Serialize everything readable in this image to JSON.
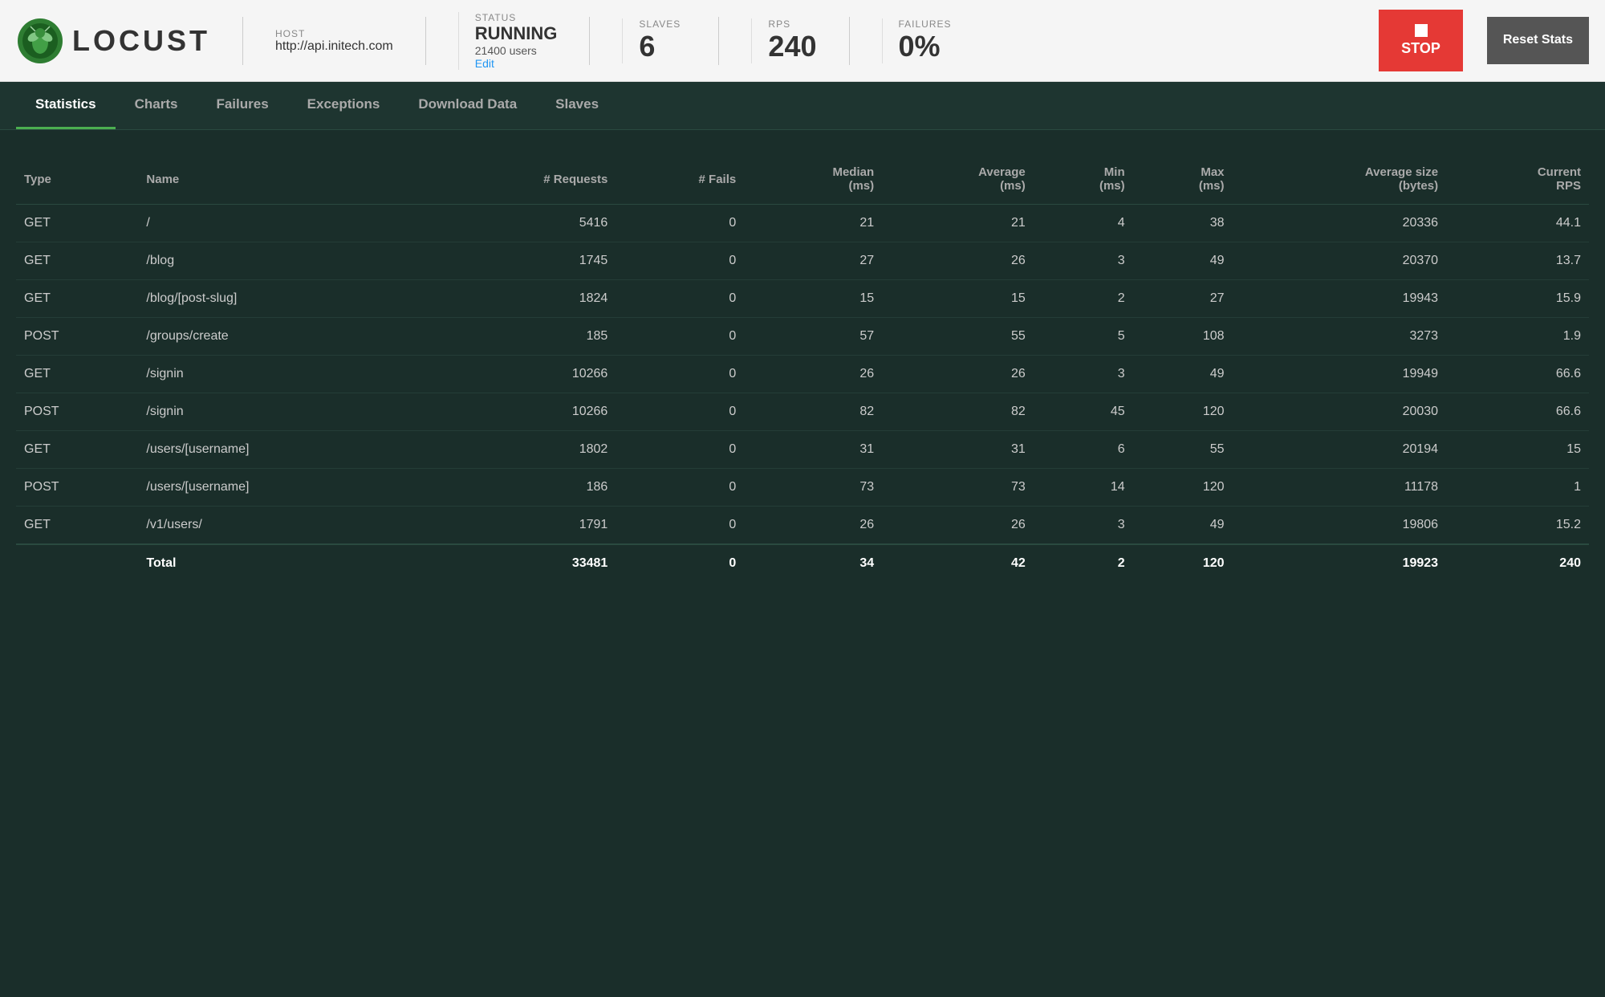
{
  "header": {
    "logo_text": "LOCUST",
    "host_label": "HOST",
    "host_value": "http://api.initech.com",
    "status_label": "STATUS",
    "status_value": "RUNNING",
    "users_value": "21400 users",
    "edit_label": "Edit",
    "slaves_label": "SLAVES",
    "slaves_value": "6",
    "rps_label": "RPS",
    "rps_value": "240",
    "failures_label": "FAILURES",
    "failures_value": "0%",
    "stop_label": "STOP",
    "reset_label": "Reset Stats"
  },
  "nav": {
    "tabs": [
      {
        "label": "Statistics",
        "active": true
      },
      {
        "label": "Charts",
        "active": false
      },
      {
        "label": "Failures",
        "active": false
      },
      {
        "label": "Exceptions",
        "active": false
      },
      {
        "label": "Download Data",
        "active": false
      },
      {
        "label": "Slaves",
        "active": false
      }
    ]
  },
  "table": {
    "columns": [
      "Type",
      "Name",
      "# Requests",
      "# Fails",
      "Median (ms)",
      "Average (ms)",
      "Min (ms)",
      "Max (ms)",
      "Average size (bytes)",
      "Current RPS"
    ],
    "rows": [
      {
        "type": "GET",
        "name": "/",
        "requests": "5416",
        "fails": "0",
        "median": "21",
        "average": "21",
        "min": "4",
        "max": "38",
        "avg_size": "20336",
        "rps": "44.1"
      },
      {
        "type": "GET",
        "name": "/blog",
        "requests": "1745",
        "fails": "0",
        "median": "27",
        "average": "26",
        "min": "3",
        "max": "49",
        "avg_size": "20370",
        "rps": "13.7"
      },
      {
        "type": "GET",
        "name": "/blog/[post-slug]",
        "requests": "1824",
        "fails": "0",
        "median": "15",
        "average": "15",
        "min": "2",
        "max": "27",
        "avg_size": "19943",
        "rps": "15.9"
      },
      {
        "type": "POST",
        "name": "/groups/create",
        "requests": "185",
        "fails": "0",
        "median": "57",
        "average": "55",
        "min": "5",
        "max": "108",
        "avg_size": "3273",
        "rps": "1.9"
      },
      {
        "type": "GET",
        "name": "/signin",
        "requests": "10266",
        "fails": "0",
        "median": "26",
        "average": "26",
        "min": "3",
        "max": "49",
        "avg_size": "19949",
        "rps": "66.6"
      },
      {
        "type": "POST",
        "name": "/signin",
        "requests": "10266",
        "fails": "0",
        "median": "82",
        "average": "82",
        "min": "45",
        "max": "120",
        "avg_size": "20030",
        "rps": "66.6"
      },
      {
        "type": "GET",
        "name": "/users/[username]",
        "requests": "1802",
        "fails": "0",
        "median": "31",
        "average": "31",
        "min": "6",
        "max": "55",
        "avg_size": "20194",
        "rps": "15"
      },
      {
        "type": "POST",
        "name": "/users/[username]",
        "requests": "186",
        "fails": "0",
        "median": "73",
        "average": "73",
        "min": "14",
        "max": "120",
        "avg_size": "11178",
        "rps": "1"
      },
      {
        "type": "GET",
        "name": "/v1/users/",
        "requests": "1791",
        "fails": "0",
        "median": "26",
        "average": "26",
        "min": "3",
        "max": "49",
        "avg_size": "19806",
        "rps": "15.2"
      }
    ],
    "total": {
      "label": "Total",
      "requests": "33481",
      "fails": "0",
      "median": "34",
      "average": "42",
      "min": "2",
      "max": "120",
      "avg_size": "19923",
      "rps": "240"
    }
  }
}
